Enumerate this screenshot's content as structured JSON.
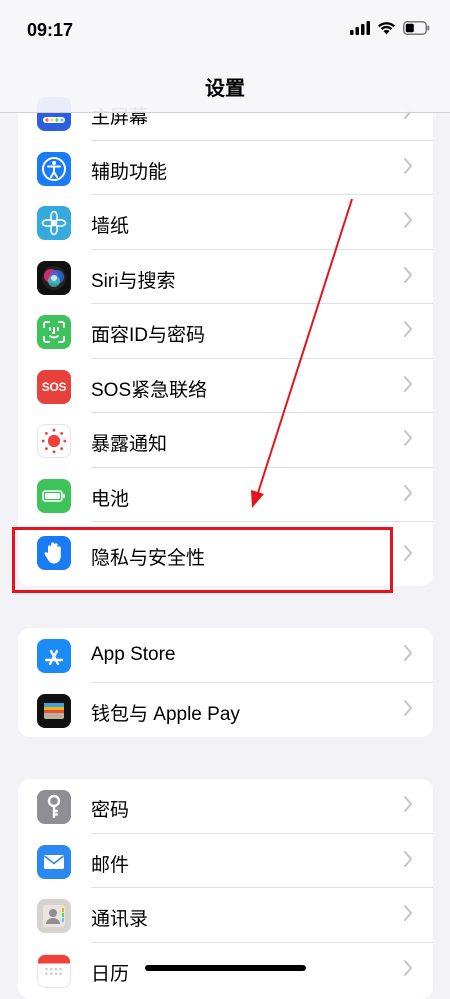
{
  "status_bar": {
    "time": "09:17"
  },
  "nav": {
    "title": "设置"
  },
  "group1": {
    "items": [
      {
        "label": "主屏幕",
        "icon": "home-screen-icon"
      },
      {
        "label": "辅助功能",
        "icon": "accessibility-icon"
      },
      {
        "label": "墙纸",
        "icon": "wallpaper-icon"
      },
      {
        "label": "Siri与搜索",
        "icon": "siri-icon"
      },
      {
        "label": "面容ID与密码",
        "icon": "face-id-icon"
      },
      {
        "label": "SOS紧急联络",
        "icon": "sos-icon",
        "icon_text": "SOS"
      },
      {
        "label": "暴露通知",
        "icon": "exposure-notification-icon"
      },
      {
        "label": "电池",
        "icon": "battery-icon"
      },
      {
        "label": "隐私与安全性",
        "icon": "privacy-hand-icon"
      }
    ]
  },
  "group2": {
    "items": [
      {
        "label": "App Store",
        "icon": "app-store-icon"
      },
      {
        "label": "钱包与 Apple Pay",
        "icon": "wallet-icon"
      }
    ]
  },
  "group3": {
    "items": [
      {
        "label": "密码",
        "icon": "key-icon"
      },
      {
        "label": "邮件",
        "icon": "mail-icon"
      },
      {
        "label": "通讯录",
        "icon": "contacts-icon"
      },
      {
        "label": "日历",
        "icon": "calendar-icon"
      }
    ]
  },
  "colors": {
    "highlight_box": "#e5141c",
    "annotation_arrow": "#e5141c",
    "background": "#f2f2f7"
  }
}
